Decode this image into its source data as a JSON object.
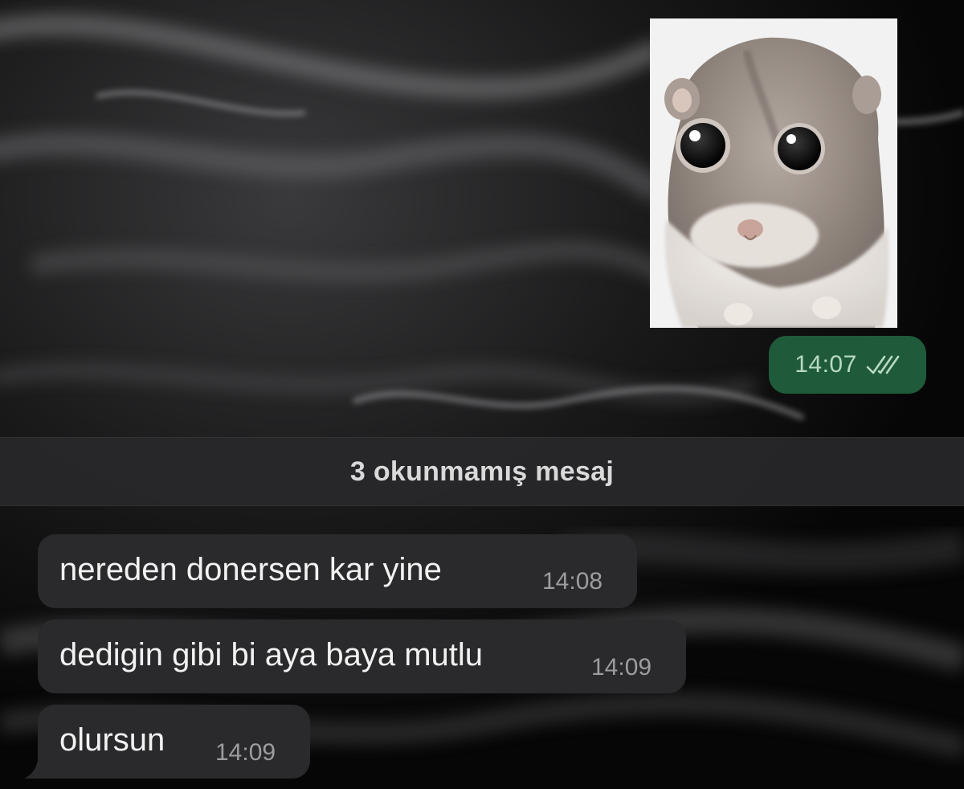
{
  "outgoing": {
    "sticker_name": "sad-hamster-sticker",
    "time": "14:07",
    "status_icon": "double-check-icon"
  },
  "unread_separator": {
    "text": "3 okunmamış mesaj"
  },
  "incoming": [
    {
      "text": "nereden donersen kar yine",
      "time": "14:08"
    },
    {
      "text": "dedigin gibi bi aya baya mutlu",
      "time": "14:09"
    },
    {
      "text": "olursun",
      "time": "14:09"
    }
  ],
  "colors": {
    "outgoing_bubble": "#1f5b3a",
    "incoming_bubble": "#2a2a2c",
    "separator": "#28282a"
  }
}
